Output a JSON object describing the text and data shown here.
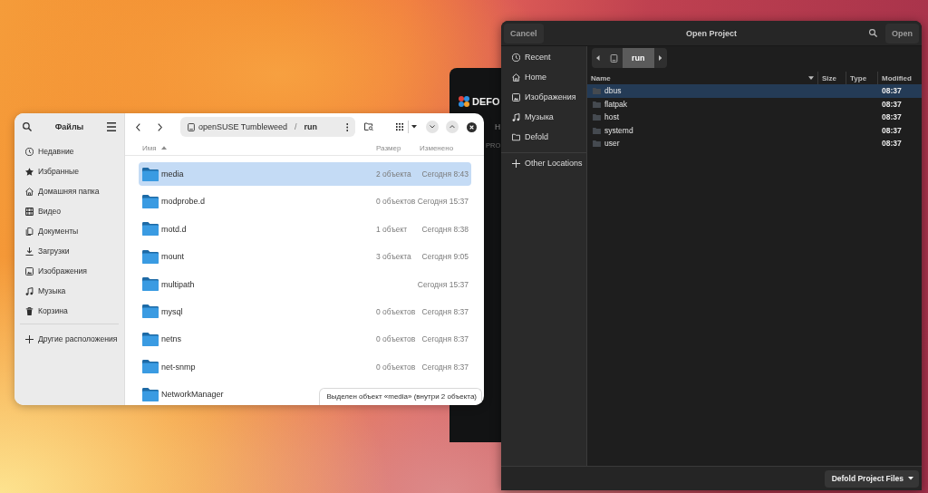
{
  "background_window": {
    "logo_text": "DEFO",
    "nav_label": "H",
    "section_label": "PRO"
  },
  "files_window": {
    "title": "Файлы",
    "places": [
      {
        "kind": "recent",
        "label": "Недавние"
      },
      {
        "kind": "starred",
        "label": "Избранные"
      },
      {
        "kind": "home",
        "label": "Домашняя папка"
      },
      {
        "kind": "videos",
        "label": "Видео"
      },
      {
        "kind": "documents",
        "label": "Документы"
      },
      {
        "kind": "downloads",
        "label": "Загрузки"
      },
      {
        "kind": "pictures",
        "label": "Изображения"
      },
      {
        "kind": "music",
        "label": "Музыка"
      },
      {
        "kind": "trash",
        "label": "Корзина"
      }
    ],
    "other_places": [
      {
        "kind": "other",
        "label": "Другие расположения"
      }
    ],
    "path": {
      "separator": "/",
      "segments": [
        {
          "kind": "drive",
          "label": "openSUSE Tumbleweed",
          "current": false
        },
        {
          "kind": "folder",
          "label": "run",
          "current": true
        }
      ]
    },
    "sort_descending": false,
    "columns": [
      {
        "label": "Имя",
        "sorted": true
      },
      {
        "label": "Размер",
        "sorted": false
      },
      {
        "label": "Изменено",
        "sorted": false
      }
    ],
    "rows": [
      {
        "name": "media",
        "size": "2 объекта",
        "modified": "Сегодня 8:43",
        "selected": true
      },
      {
        "name": "modprobe.d",
        "size": "0 объектов",
        "modified": "Сегодня 15:37",
        "selected": false
      },
      {
        "name": "motd.d",
        "size": "1 объект",
        "modified": "Сегодня 8:38",
        "selected": false
      },
      {
        "name": "mount",
        "size": "3 объекта",
        "modified": "Сегодня 9:05",
        "selected": false
      },
      {
        "name": "multipath",
        "modified": "Сегодня 15:37",
        "selected": false
      },
      {
        "name": "mysql",
        "size": "0 объектов",
        "modified": "Сегодня 8:37",
        "selected": false
      },
      {
        "name": "netns",
        "size": "0 объектов",
        "modified": "Сегодня 8:37",
        "selected": false
      },
      {
        "name": "net-snmp",
        "size": "0 объектов",
        "modified": "Сегодня 8:37",
        "selected": false
      },
      {
        "name": "NetworkManager",
        "selected": false
      }
    ],
    "status": "Выделен объект «media» (внутри 2 объекта)"
  },
  "dialog": {
    "cancel": "Cancel",
    "title": "Open Project",
    "open": "Open",
    "places": [
      {
        "kind": "recent",
        "label": "Recent"
      },
      {
        "kind": "home",
        "label": "Home"
      },
      {
        "kind": "pictures",
        "label": "Изображения"
      },
      {
        "kind": "music",
        "label": "Музыка"
      },
      {
        "kind": "folder",
        "label": "Defold"
      }
    ],
    "other_places": [
      {
        "kind": "other",
        "label": "Other Locations"
      }
    ],
    "path": {
      "segments": [
        {
          "kind": "drive",
          "current": false
        },
        {
          "kind": "folder",
          "label": "run",
          "current": true
        }
      ]
    },
    "sort_descending": true,
    "columns": [
      {
        "label": "Name",
        "sorted": true
      },
      {
        "label": "Size",
        "sorted": false
      },
      {
        "label": "Type",
        "sorted": false
      },
      {
        "label": "Modified",
        "sorted": false
      }
    ],
    "rows": [
      {
        "name": "dbus",
        "modified": "08:37",
        "selected": true
      },
      {
        "name": "flatpak",
        "modified": "08:37",
        "selected": false
      },
      {
        "name": "host",
        "modified": "08:37",
        "selected": false
      },
      {
        "name": "systemd",
        "modified": "08:37",
        "selected": false
      },
      {
        "name": "user",
        "modified": "08:37",
        "selected": false
      }
    ],
    "filter": "Defold Project Files"
  }
}
